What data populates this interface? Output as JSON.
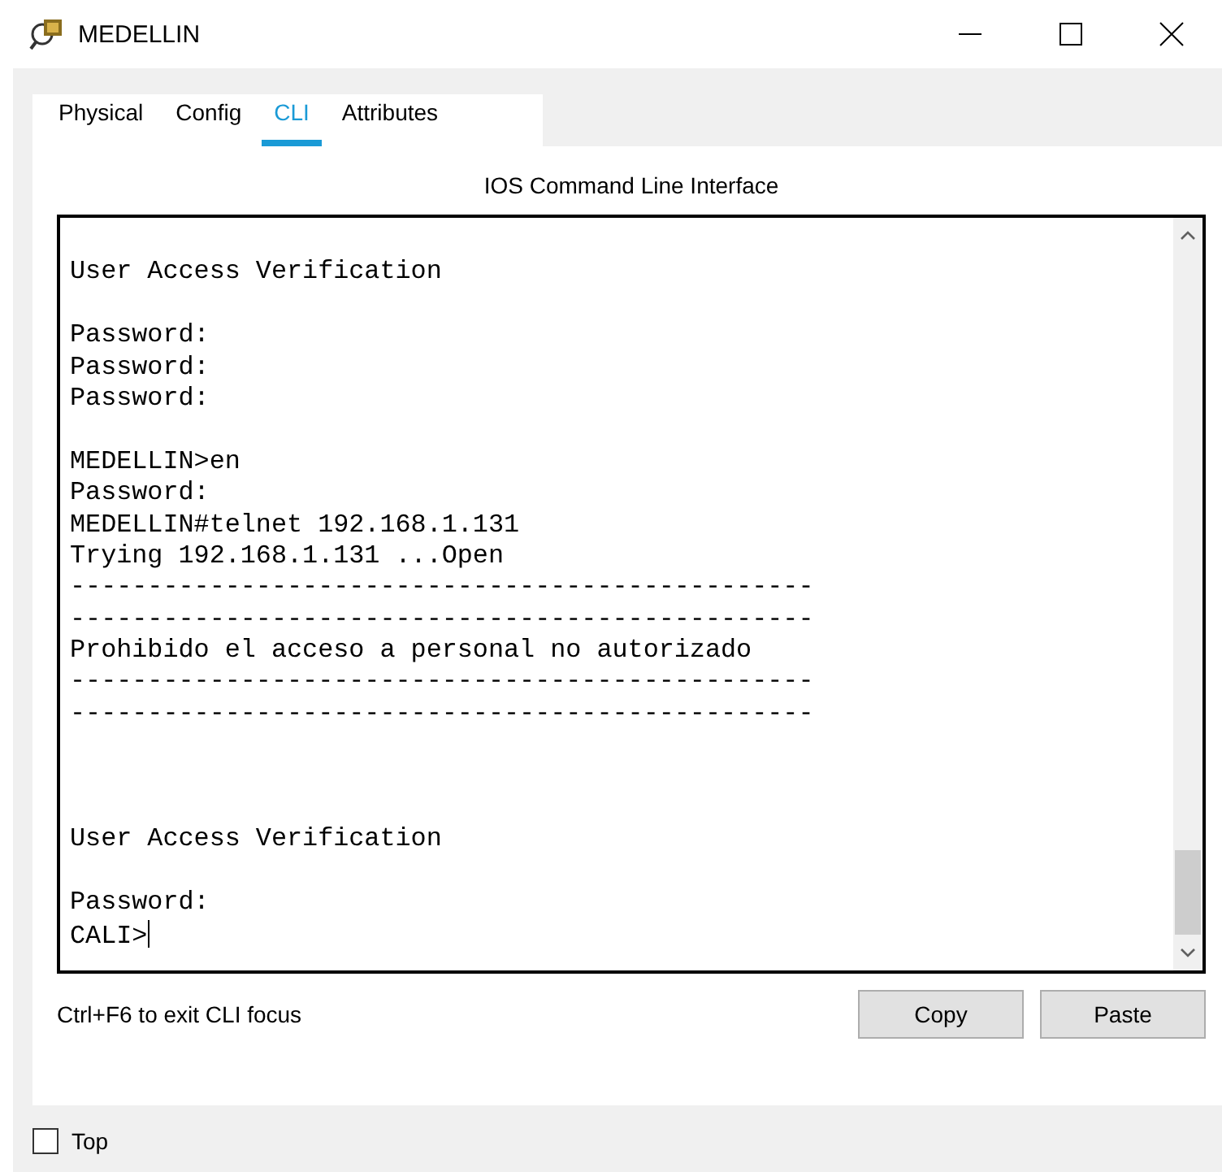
{
  "window": {
    "title": "MEDELLIN"
  },
  "tabs": [
    {
      "label": "Physical",
      "selected": false
    },
    {
      "label": "Config",
      "selected": false
    },
    {
      "label": "CLI",
      "selected": true
    },
    {
      "label": "Attributes",
      "selected": false
    }
  ],
  "cli": {
    "heading": "IOS Command Line Interface",
    "lines": [
      {
        "kind": "blank"
      },
      {
        "kind": "text",
        "text": "User Access Verification"
      },
      {
        "kind": "blank"
      },
      {
        "kind": "text",
        "text": "Password:"
      },
      {
        "kind": "text",
        "text": "Password:"
      },
      {
        "kind": "text",
        "text": "Password:"
      },
      {
        "kind": "blank"
      },
      {
        "kind": "text",
        "text": "MEDELLIN>en"
      },
      {
        "kind": "text",
        "text": "Password:"
      },
      {
        "kind": "text",
        "text": "MEDELLIN#telnet 192.168.1.131"
      },
      {
        "kind": "text",
        "text": "Trying 192.168.1.131 ...Open"
      },
      {
        "kind": "text",
        "text": "------------------------------------------------"
      },
      {
        "kind": "text",
        "text": "------------------------------------------------"
      },
      {
        "kind": "text",
        "text": "Prohibido el acceso a personal no autorizado"
      },
      {
        "kind": "text",
        "text": "------------------------------------------------"
      },
      {
        "kind": "text",
        "text": "------------------------------------------------"
      },
      {
        "kind": "blank"
      },
      {
        "kind": "blank"
      },
      {
        "kind": "blank"
      },
      {
        "kind": "text",
        "text": "User Access Verification"
      },
      {
        "kind": "blank"
      },
      {
        "kind": "text",
        "text": "Password:"
      },
      {
        "kind": "text",
        "text": "CALI>",
        "cursor": true
      }
    ],
    "hint": "Ctrl+F6 to exit CLI focus",
    "buttons": [
      "Copy",
      "Paste"
    ]
  },
  "top_checkbox": {
    "label": "Top",
    "checked": false
  }
}
